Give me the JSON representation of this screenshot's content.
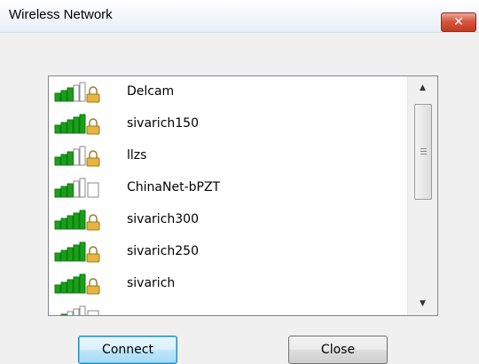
{
  "window": {
    "title": "Wireless Network",
    "close_glyph": "✕"
  },
  "networks": [
    {
      "ssid": "Delcam",
      "signal_bars": 3,
      "secured": true
    },
    {
      "ssid": "sivarich150",
      "signal_bars": 5,
      "secured": true
    },
    {
      "ssid": "llzs",
      "signal_bars": 3,
      "secured": true
    },
    {
      "ssid": "ChinaNet-bPZT",
      "signal_bars": 3,
      "secured": false
    },
    {
      "ssid": "sivarich300",
      "signal_bars": 5,
      "secured": true
    },
    {
      "ssid": "sivarich250",
      "signal_bars": 5,
      "secured": true
    },
    {
      "ssid": "sivarich",
      "signal_bars": 5,
      "secured": true
    },
    {
      "ssid": "",
      "signal_bars": 2,
      "secured": false
    }
  ],
  "buttons": {
    "connect_label": "Connect",
    "close_label": "Close"
  },
  "colors": {
    "signal_on": "#1aa01a",
    "signal_off": "#ffffff",
    "lock": "#e8b43c",
    "selection_border": "#3c7fb1"
  },
  "icons": {
    "signal": "wifi-signal-icon",
    "lock": "lock-icon",
    "scroll_up": "▲",
    "scroll_down": "▼"
  }
}
